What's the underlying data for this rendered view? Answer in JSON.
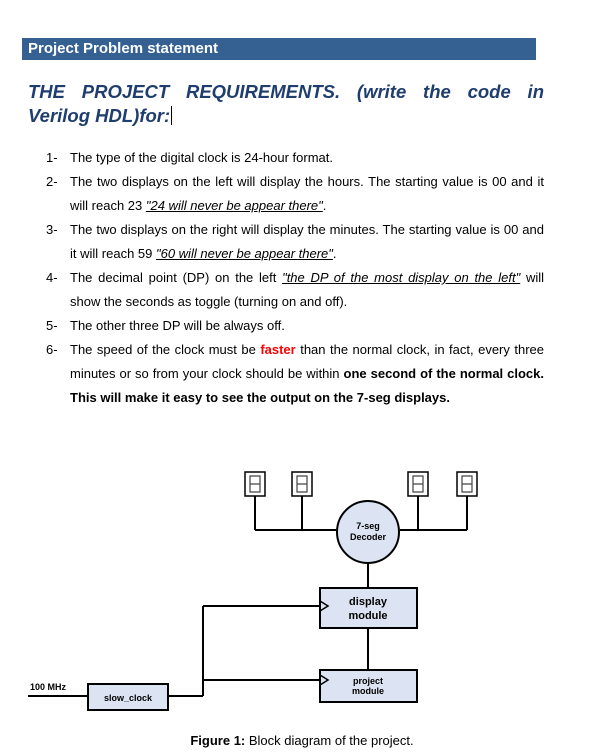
{
  "section_banner": "Project Problem statement",
  "requirements_title": {
    "line1": "THE PROJECT REQUIREMENTS. (write the code in",
    "line2": "Verilog HDL)for:"
  },
  "requirements": [
    {
      "num": "1-",
      "parts": [
        {
          "text": "The type of the digital clock is 24-hour format.",
          "style": "normal"
        }
      ]
    },
    {
      "num": "2-",
      "parts": [
        {
          "text": "The two displays on the left will display the hours. The starting value is 00 and it will reach 23 ",
          "style": "normal"
        },
        {
          "text": "\"24 will never be appear there\"",
          "style": "italic-underline"
        },
        {
          "text": ".",
          "style": "normal"
        }
      ]
    },
    {
      "num": "3-",
      "parts": [
        {
          "text": "The two displays on the right will display the minutes. The starting value is 00 and it will reach 59 ",
          "style": "normal"
        },
        {
          "text": "\"60 will never be appear there\"",
          "style": "italic-underline"
        },
        {
          "text": ".",
          "style": "normal"
        }
      ]
    },
    {
      "num": "4-",
      "parts": [
        {
          "text": "The decimal point (DP) on the left ",
          "style": "normal"
        },
        {
          "text": "\"the DP of the most display on the left\"",
          "style": "italic-underline"
        },
        {
          "text": " will show the seconds as toggle (turning on and off).",
          "style": "normal"
        }
      ]
    },
    {
      "num": "5-",
      "parts": [
        {
          "text": "The other three DP will be always off.",
          "style": "normal"
        }
      ]
    },
    {
      "num": "6-",
      "parts": [
        {
          "text": "The speed of the clock must be ",
          "style": "normal"
        },
        {
          "text": "faster",
          "style": "red-bold"
        },
        {
          "text": " than the normal clock, in fact, every three minutes or so from your clock should be within ",
          "style": "normal"
        },
        {
          "text": "one second of the normal clock. This will make it easy to see the output on the 7-seg displays.",
          "style": "bold"
        }
      ]
    }
  ],
  "diagram": {
    "decoder_label_1": "7-seg",
    "decoder_label_2": "Decoder",
    "display_module_1": "display",
    "display_module_2": "module",
    "project_module_1": "project",
    "project_module_2": "module",
    "slow_clock": "slow_clock",
    "input_clock": "100 MHz",
    "seven_seg_count": 4
  },
  "caption": {
    "label": "Figure 1:",
    "text": " Block diagram of the project."
  },
  "colors": {
    "banner_bg": "#356192",
    "title_color": "#1F3D6E",
    "block_fill": "#DCE3F2",
    "highlight_red": "#FF0000"
  }
}
